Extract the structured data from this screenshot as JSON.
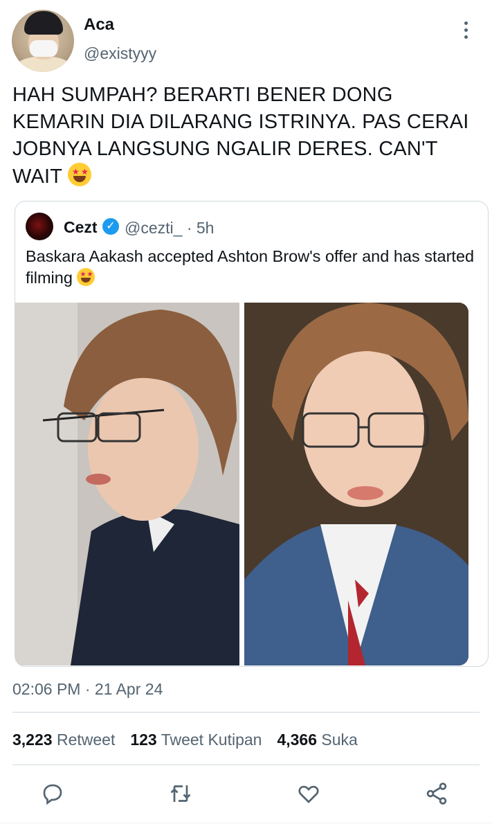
{
  "author": {
    "display_name": "Aca",
    "handle": "@existyyy"
  },
  "tweet": {
    "text": "HAH SUMPAH? BERARTI BENER DONG KEMARIN DIA DILARANG ISTRINYA. PAS CERAI JOBNYA LANGSUNG NGALIR DERES. CAN'T WAIT",
    "emoji": "star-struck-emoji"
  },
  "quoted": {
    "display_name": "Cezt",
    "handle_time": "@cezti_ · 5h",
    "text": "Baskara Aakash accepted Ashton Brow's offer and has started filming",
    "emoji": "star-struck-emoji"
  },
  "timestamp": "02:06 PM · 21 Apr 24",
  "stats": {
    "retweets_count": "3,223",
    "retweets_label": "Retweet",
    "quotes_count": "123",
    "quotes_label": "Tweet Kutipan",
    "likes_count": "4,366",
    "likes_label": "Suka"
  },
  "actions": [
    "reply-icon",
    "retweet-icon",
    "like-icon",
    "share-icon"
  ],
  "colors": {
    "text_primary": "#0f1419",
    "text_secondary": "#536471",
    "border": "#cfd9de",
    "verified": "#1d9bf0"
  }
}
